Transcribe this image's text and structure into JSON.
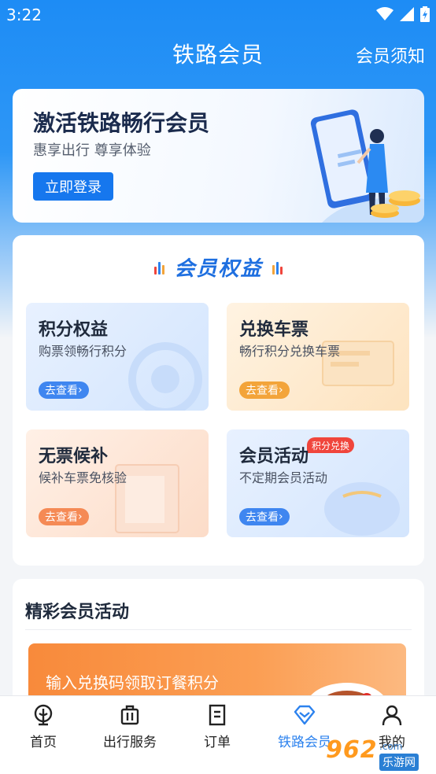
{
  "status_bar": {
    "time": "3:22"
  },
  "header": {
    "title": "铁路会员",
    "right_link": "会员须知"
  },
  "banner": {
    "title": "激活铁路畅行会员",
    "subtitle": "惠享出行 尊享体验",
    "login_button": "立即登录"
  },
  "benefits": {
    "title": "会员权益",
    "tiles": [
      {
        "title": "积分权益",
        "subtitle": "购票领畅行积分",
        "button": "去查看",
        "theme_color": "#3f86f0"
      },
      {
        "title": "兑换车票",
        "subtitle": "畅行积分兑换车票",
        "button": "去查看",
        "theme_color": "#f3a43a"
      },
      {
        "title": "无票候补",
        "subtitle": "候补车票免核验",
        "button": "去查看",
        "theme_color": "#f58a55"
      },
      {
        "title": "会员活动",
        "subtitle": "不定期会员活动",
        "button": "去查看",
        "tag": "积分兑换",
        "theme_color": "#3f86f0"
      }
    ]
  },
  "activities": {
    "title": "精彩会员活动",
    "banner_text": "输入兑换码领取订餐积分"
  },
  "tab_bar": {
    "tabs": [
      {
        "label": "首页",
        "icon": "rail-logo-icon"
      },
      {
        "label": "出行服务",
        "icon": "luggage-icon"
      },
      {
        "label": "订单",
        "icon": "order-doc-icon"
      },
      {
        "label": "铁路会员",
        "icon": "diamond-icon",
        "active": true
      },
      {
        "label": "我的",
        "icon": "user-icon"
      }
    ]
  },
  "watermark": {
    "number": "962",
    "domain": ".com",
    "site": "乐游网"
  },
  "colors": {
    "primary": "#2c82ee",
    "header_blue": "#1d8cf5",
    "tag_red": "#f0453c"
  }
}
